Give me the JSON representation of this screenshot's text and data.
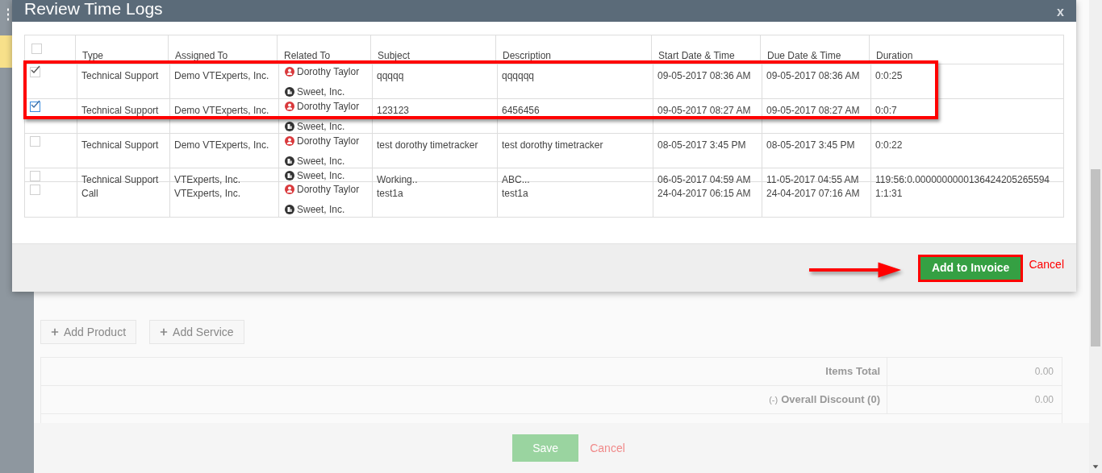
{
  "modal": {
    "title": "Review Time Logs",
    "close": "x",
    "table": {
      "columns": [
        "Type",
        "Assigned To",
        "Related To",
        "Subject",
        "Description",
        "Start Date & Time",
        "Due Date & Time",
        "Duration"
      ],
      "select_all": {
        "checked": false
      },
      "rows": [
        {
          "checked": true,
          "focused": false,
          "type": "Technical Support",
          "assigned_to": "Demo VTExperts, Inc.",
          "related_to": [
            {
              "kind": "contact",
              "name": "Dorothy Taylor"
            },
            {
              "kind": "account",
              "name": "Sweet, Inc."
            }
          ],
          "subject": "qqqqq",
          "description": "qqqqqq",
          "start": "09-05-2017 08:36 AM",
          "due": "09-05-2017 08:36 AM",
          "duration": "0:0:25"
        },
        {
          "checked": true,
          "focused": true,
          "type": "Technical Support",
          "assigned_to": "Demo VTExperts, Inc.",
          "related_to": [
            {
              "kind": "contact",
              "name": "Dorothy Taylor"
            },
            {
              "kind": "account",
              "name": "Sweet, Inc."
            }
          ],
          "subject": "123123",
          "description": "6456456",
          "start": "09-05-2017 08:27 AM",
          "due": "09-05-2017 08:27 AM",
          "duration": "0:0:7"
        },
        {
          "checked": false,
          "focused": false,
          "type": "Technical Support",
          "assigned_to": "Demo VTExperts, Inc.",
          "related_to": [
            {
              "kind": "contact",
              "name": "Dorothy Taylor"
            },
            {
              "kind": "account",
              "name": "Sweet, Inc."
            }
          ],
          "subject": "test dorothy timetracker",
          "description": "test dorothy timetracker",
          "start": "08-05-2017 3:45 PM",
          "due": "08-05-2017 3:45 PM",
          "duration": "0:0:22"
        },
        {
          "checked": false,
          "focused": false,
          "type": "Technical Support",
          "assigned_to": "VTExperts, Inc.",
          "related_to": [
            {
              "kind": "account",
              "name": "Sweet, Inc."
            }
          ],
          "subject": "Working..",
          "description": "ABC...",
          "start": "06-05-2017 04:59 AM",
          "due": "11-05-2017 04:55 AM",
          "duration": "119:56:0.0000000000136424205265594"
        },
        {
          "checked": false,
          "focused": false,
          "type": "Call",
          "assigned_to": "VTExperts, Inc.",
          "related_to": [
            {
              "kind": "contact",
              "name": "Dorothy Taylor"
            },
            {
              "kind": "account",
              "name": "Sweet, Inc."
            }
          ],
          "subject": "test1a",
          "description": "test1a",
          "start": "24-04-2017 06:15 AM",
          "due": "24-04-2017 07:16 AM",
          "duration": "1:1:31"
        }
      ]
    },
    "footer": {
      "primary": "Add to Invoice",
      "cancel": "Cancel"
    }
  },
  "page": {
    "add_buttons": [
      "Add Product",
      "Add Service"
    ],
    "totals": [
      {
        "label": "Items Total",
        "value": "0.00"
      },
      {
        "prefix": "(-)",
        "label": "Overall Discount (0)",
        "value": "0.00"
      }
    ],
    "save": "Save",
    "cancel": "Cancel"
  }
}
